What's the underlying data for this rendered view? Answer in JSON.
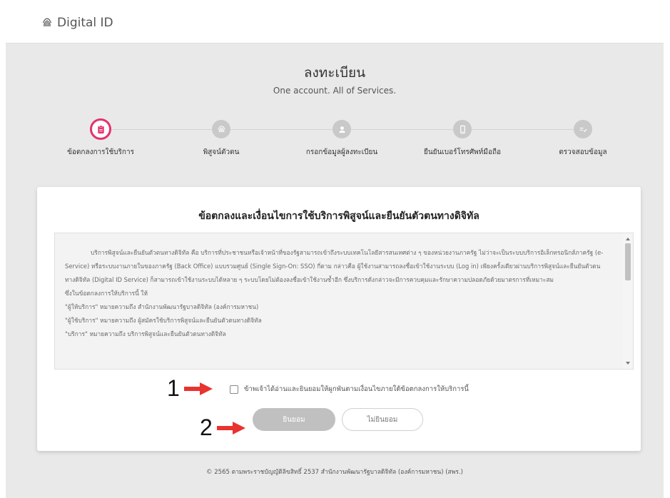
{
  "header": {
    "brand": "Digital ID",
    "brand_icon": "fingerprint-icon"
  },
  "page": {
    "title": "ลงทะเบียน",
    "subtitle": "One account. All of Services."
  },
  "steps": [
    {
      "label": "ข้อตกลงการใช้บริการ",
      "icon": "clipboard-icon",
      "active": true
    },
    {
      "label": "พิสูจน์ตัวตน",
      "icon": "fingerprint-icon",
      "active": false
    },
    {
      "label": "กรอกข้อมูลผู้ลงทะเบียน",
      "icon": "user-icon",
      "active": false
    },
    {
      "label": "ยืนยันเบอร์โทรศัพท์มือถือ",
      "icon": "mobile-icon",
      "active": false
    },
    {
      "label": "ตรวจสอบข้อมูล",
      "icon": "checklist-icon",
      "active": false
    }
  ],
  "card": {
    "title": "ข้อตกลงและเงื่อนไขการใช้บริการพิสูจน์และยืนยันตัวตนทางดิจิทัล",
    "terms": [
      "บริการพิสูจน์และยืนยันตัวตนทางดิจิทัล คือ บริการที่ประชาชนหรือเจ้าหน้าที่ของรัฐสามารถเข้าถึงระบบเทคโนโลยีสารสนเทศต่าง ๆ ของหน่วยงานภาครัฐ ไม่ว่าจะเป็นระบบบริการอิเล็กทรอนิกส์ภาครัฐ (e-Service) หรือระบบงานภายในของภาครัฐ (Back Office) แบบรวมศูนย์ (Single Sign-On: SSO) กี่ตาม กล่าวคือ ผู้ใช้งานสามารถลงชื่อเข้าใช้งานระบบ (Log in) เพียงครั้งเดียวผ่านบริการพิสูจน์และยืนยันตัวตนทางดิจิทัล (Digital ID Service) ก็สามารถเข้าใช้งานระบบได้หลาย ๆ ระบบโดยไม่ต้องลงชื่อเข้าใช้งานซ้ำอีก ซึ่งบริการดังกล่าวจะมีการควบคุมและรักษาความปลอดภัยด้วยมาตรการที่เหมาะสม",
      "ซึ่งในข้อตกลงการให้บริการนี้ ให้",
      "\"ผู้ให้บริการ\" หมายความถึง สำนักงานพัฒนารัฐบาลดิจิทัล (องค์การมหาชน)",
      "\"ผู้ใช้บริการ\" หมายความถึง ผู้สมัครใช้บริการพิสูจน์และยืนยันตัวตนทางดิจิทัล",
      "\"บริการ\" หมายความถึง บริการพิสูจน์และยืนยันตัวตนทางดิจิทัล"
    ],
    "agree_label": "ข้าพเจ้าได้อ่านและยินยอมให้ผูกพันตามเงื่อนไขภายใต้ข้อตกลงการให้บริการนี้",
    "agree_checked": false,
    "accept_label": "ยินยอม",
    "decline_label": "ไม่ยินยอม"
  },
  "annotations": [
    {
      "number": "1",
      "color": "#e8332f"
    },
    {
      "number": "2",
      "color": "#e8332f"
    }
  ],
  "footer": "© 2565 ตามพระราชบัญญัติลิขสิทธิ์ 2537 สำนักงานพัฒนารัฐบาลดิจิทัล (องค์การมหาชน) (สพร.)",
  "colors": {
    "accent": "#e2336b",
    "step_inactive": "#c9c9c9",
    "annotation_arrow": "#e8332f"
  }
}
